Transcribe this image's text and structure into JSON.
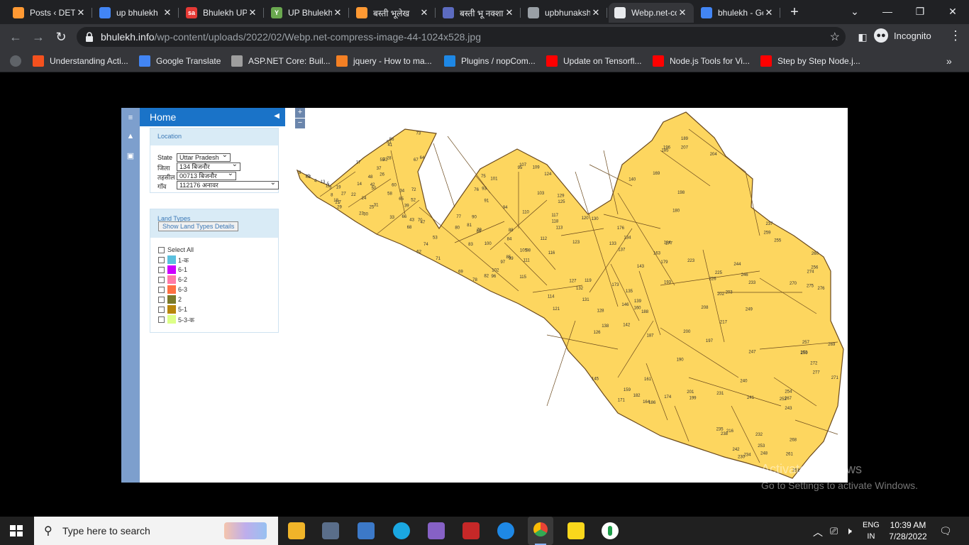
{
  "browser": {
    "tabs": [
      {
        "title": "Posts ‹ DET",
        "icon": "india-flag-icon",
        "color": "#ff9933"
      },
      {
        "title": "up bhulekh",
        "icon": "google-icon",
        "color": "#4285f4"
      },
      {
        "title": "Bhulekh UP",
        "icon": "sa-icon",
        "color": "#e53935",
        "badge": "sa"
      },
      {
        "title": "UP Bhulekh",
        "icon": "y-icon",
        "color": "#6aa84f",
        "badge": "Y"
      },
      {
        "title": "बस्ती भूलेख",
        "icon": "india-flag-icon",
        "color": "#ff9933"
      },
      {
        "title": "बस्ती भू नक्शा",
        "icon": "emblem-icon",
        "color": "#5c6bc0"
      },
      {
        "title": "upbhunaksha",
        "icon": "globe-icon",
        "color": "#9aa0a6"
      },
      {
        "title": "Webp.net-compress",
        "icon": "globe-icon",
        "color": "#e8eaed",
        "active": true
      },
      {
        "title": "bhulekh - Google Docs",
        "icon": "docs-icon",
        "color": "#4285f4"
      }
    ],
    "url_host": "bhulekh.info",
    "url_path": "/wp-content/uploads/2022/02/Webp.net-compress-image-44-1024x528.jpg",
    "incognito_label": "Incognito",
    "bookmarks": [
      {
        "label": "Understanding Acti...",
        "color": "#f4511e"
      },
      {
        "label": "Google Translate",
        "color": "#4285f4"
      },
      {
        "label": "ASP.NET Core: Buil...",
        "color": "#9e9e9e"
      },
      {
        "label": "jquery - How to ma...",
        "color": "#f48024"
      },
      {
        "label": "Plugins / nopCom...",
        "color": "#1e88e5"
      },
      {
        "label": "Update on Tensorfl...",
        "color": "#ff0000"
      },
      {
        "label": "Node.js Tools for Vi...",
        "color": "#ff0000"
      },
      {
        "label": "Step by Step Node.j...",
        "color": "#ff0000"
      }
    ]
  },
  "app": {
    "home_title": "Home",
    "location_header": "Location",
    "fields": [
      {
        "label": "State",
        "value": "Uttar Pradesh"
      },
      {
        "label": "जिला",
        "value": "134 बिजनौर"
      },
      {
        "label": "तहसील",
        "value": "00713 बिजनौर"
      },
      {
        "label": "गाँव",
        "value": "112176 अनावर"
      }
    ],
    "land_types_header": "Land Types",
    "show_details_button": "Show Land Types Details",
    "select_all": "Select All",
    "land_types": [
      {
        "label": "1-क",
        "color": "#5bc0de"
      },
      {
        "label": "6-1",
        "color": "#cc00ff"
      },
      {
        "label": "6-2",
        "color": "#ff7aa8"
      },
      {
        "label": "6-3",
        "color": "#ff7043"
      },
      {
        "label": "2",
        "color": "#7a7a2a"
      },
      {
        "label": "5-1",
        "color": "#b8860b"
      },
      {
        "label": "5-3-क",
        "color": "#ddff88"
      }
    ],
    "zoom_in": "+",
    "zoom_out": "−",
    "map_fill": "#fdd65f",
    "map_stroke": "#6b4a1e",
    "plot_numbers": [
      "2",
      "3",
      "4",
      "5",
      "6",
      "7",
      "8",
      "9",
      "10",
      "11",
      "13",
      "14",
      "17",
      "18",
      "19",
      "21",
      "22",
      "23",
      "24",
      "25",
      "26",
      "27",
      "28",
      "29",
      "30",
      "31",
      "32",
      "33",
      "34",
      "37",
      "39",
      "41",
      "42",
      "43",
      "47",
      "48",
      "50",
      "51",
      "52",
      "53",
      "55",
      "56",
      "58",
      "60",
      "62",
      "64",
      "65",
      "66",
      "67",
      "68",
      "69",
      "70",
      "71",
      "72",
      "73",
      "74",
      "75",
      "76",
      "77",
      "78",
      "79",
      "80",
      "81",
      "82",
      "83",
      "84",
      "85",
      "86",
      "88",
      "90",
      "91",
      "93",
      "94",
      "95",
      "96",
      "97",
      "98",
      "99",
      "100",
      "101",
      "102",
      "103",
      "105",
      "107",
      "109",
      "110",
      "111",
      "112",
      "113",
      "114",
      "115",
      "116",
      "117",
      "118",
      "119",
      "120",
      "121",
      "123",
      "124",
      "125",
      "126",
      "127",
      "128",
      "129",
      "130",
      "131",
      "132",
      "133",
      "134",
      "135",
      "137",
      "138",
      "139",
      "140",
      "142",
      "143",
      "145",
      "146",
      "159",
      "160",
      "161",
      "163",
      "164",
      "169",
      "171",
      "173",
      "174",
      "176",
      "177",
      "179",
      "180",
      "182",
      "184",
      "185",
      "186",
      "187",
      "188",
      "189",
      "190",
      "193",
      "196",
      "197",
      "198",
      "199",
      "200",
      "201",
      "202",
      "203",
      "204",
      "207",
      "208",
      "216",
      "217",
      "223",
      "225",
      "226",
      "230",
      "231",
      "232",
      "233",
      "234",
      "235",
      "237",
      "238",
      "240",
      "241",
      "242",
      "243",
      "244",
      "246",
      "247",
      "248",
      "249",
      "250",
      "251",
      "252",
      "253",
      "254",
      "255",
      "256",
      "257",
      "259",
      "260",
      "261",
      "267",
      "268",
      "269",
      "270",
      "271",
      "272",
      "273",
      "274",
      "275",
      "276",
      "277"
    ]
  },
  "watermark": {
    "line1": "Activate Windows",
    "line2": "Go to Settings to activate Windows."
  },
  "taskbar": {
    "search_placeholder": "Type here to search",
    "lang_top": "ENG",
    "lang_bottom": "IN",
    "time": "10:39 AM",
    "date": "7/28/2022"
  }
}
